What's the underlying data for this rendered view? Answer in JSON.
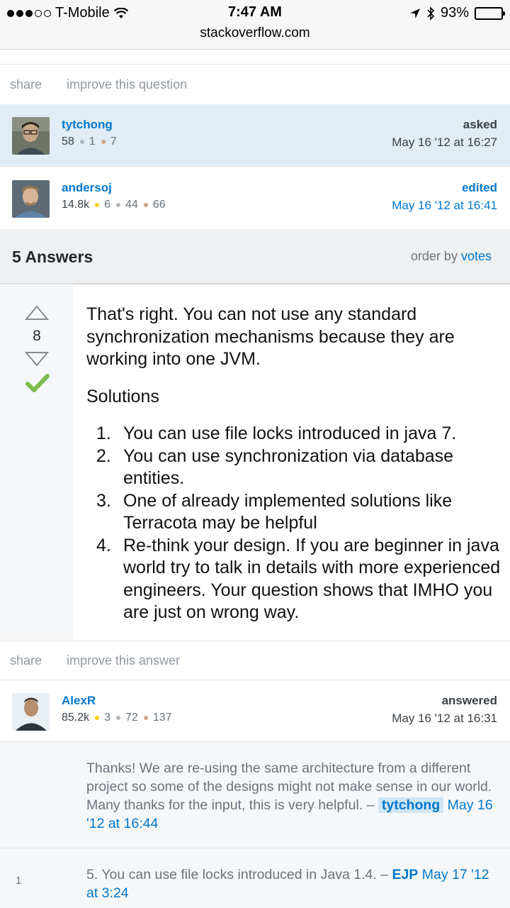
{
  "status_bar": {
    "carrier": "T-Mobile",
    "time": "7:47 AM",
    "url": "stackoverflow.com",
    "battery": "93%",
    "battery_level": 0.93
  },
  "question_actions": {
    "share": "share",
    "improve": "improve this question"
  },
  "asker": {
    "name": "tytchong",
    "rep": "58",
    "silver": "1",
    "bronze": "7",
    "action": "asked",
    "time": "May 16 '12 at 16:27"
  },
  "editor": {
    "name": "andersoj",
    "rep": "14.8k",
    "gold": "6",
    "silver": "44",
    "bronze": "66",
    "action": "edited",
    "time": "May 16 '12 at 16:41"
  },
  "answers_header": {
    "title": "5 Answers",
    "order_label": "order by",
    "order_value": "votes"
  },
  "answer": {
    "votes": "8",
    "paragraph1": "That's right. You can not use any standard synchronization mechanisms because they are working into one JVM.",
    "paragraph2": "Solutions",
    "list": [
      {
        "num": "1.",
        "text": "You can use file locks introduced in java 7."
      },
      {
        "num": "2.",
        "text": "You can use synchronization via database entities."
      },
      {
        "num": "3.",
        "text": "One of already implemented solutions like Terracota may be helpful"
      },
      {
        "num": "4.",
        "text": "Re-think your design. If you are beginner in java world try to talk in details with more experienced engineers. Your question shows that IMHO you are just on wrong way."
      }
    ]
  },
  "answer_actions": {
    "share": "share",
    "improve": "improve this answer"
  },
  "answerer": {
    "name": "AlexR",
    "rep": "85.2k",
    "gold": "3",
    "silver": "72",
    "bronze": "137",
    "action": "answered",
    "time": "May 16 '12 at 16:31"
  },
  "comments": [
    {
      "score": "",
      "text": "Thanks! We are re-using the same architecture from a different project so some of the designs might not make sense in our world. Many thanks for the input, this is very helpful. –",
      "user": "tytchong",
      "time": "May 16 '12 at 16:44"
    },
    {
      "score": "1",
      "text": "5. You can use file locks introduced in Java 1.4. –",
      "user": "EJP",
      "time": "May 17 '12 at 3:24"
    }
  ]
}
